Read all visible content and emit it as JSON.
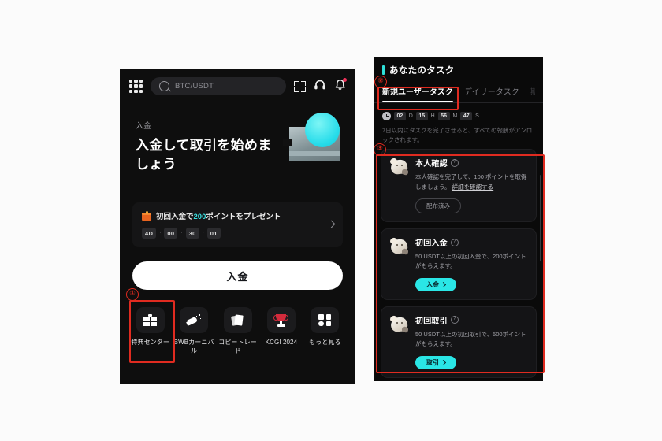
{
  "page": {
    "background": "#fbfbfb",
    "accent_cyan": "#2ae6e6",
    "annotation_red": "#e02b20"
  },
  "left_phone": {
    "topbar": {
      "menu_icon": "grid-menu-icon",
      "search_value": "BTC/USDT",
      "scan_icon": "scan-qr-icon",
      "support_icon": "headset-icon",
      "notification_icon": "bell-icon",
      "notification_dot": true
    },
    "hero": {
      "eyebrow": "入金",
      "title": "入金して取引を始めましょう",
      "art": "wallet-card-illustration"
    },
    "promo": {
      "gift_icon": "gift-box-icon",
      "text_before": "初回入金で",
      "highlight": "200",
      "text_after": "ポイントをプレゼント",
      "timer": [
        "4D",
        "00",
        "30",
        "01"
      ],
      "chevron": "chevron-right-icon"
    },
    "cta_label": "入金",
    "quick_actions": [
      {
        "icon": "gift-icon",
        "label": "特典センター"
      },
      {
        "icon": "megaphone-icon",
        "label": "BWBカーニバル"
      },
      {
        "icon": "copy-trade-icon",
        "label": "コピートレード"
      },
      {
        "icon": "trophy-icon",
        "label": "KCGI 2024"
      },
      {
        "icon": "more-grid-icon",
        "label": "もっと見る"
      }
    ]
  },
  "right_phone": {
    "header_title": "あなたのタスク",
    "tabs": [
      {
        "label": "新規ユーザータスク",
        "active": true
      },
      {
        "label": "デイリータスク",
        "active": false
      },
      {
        "label": "期間",
        "active": false,
        "cut_off": true
      }
    ],
    "countdown": {
      "clock_icon": "clock-icon",
      "days": "02",
      "days_unit": "D",
      "hours": "15",
      "hours_unit": "H",
      "minutes": "56",
      "minutes_unit": "M",
      "seconds": "47",
      "seconds_unit": "S"
    },
    "note": "7日以内にタスクを完了させると、すべての報酬がアンロックされます。",
    "tasks": [
      {
        "emoji": "bear-mascot-icon",
        "title": "本人確認",
        "info_icon": "question-mark-icon",
        "desc": "本人確認を完了して、100 ポイントを取得しましょう。",
        "link": "詳細を確認する",
        "button": {
          "label": "配布済み",
          "style": "ghost"
        }
      },
      {
        "emoji": "bear-mascot-icon",
        "title": "初回入金",
        "info_icon": "question-mark-icon",
        "desc": "50 USDT以上の初回入金で、200ポイントがもらえます。",
        "link": "",
        "button": {
          "label": "入金",
          "style": "cyan"
        }
      },
      {
        "emoji": "bear-mascot-icon",
        "title": "初回取引",
        "info_icon": "question-mark-icon",
        "desc": "50 USDT以上の初回取引で、500ポイントがもらえます。",
        "link": "",
        "button": {
          "label": "取引",
          "style": "cyan"
        }
      }
    ]
  },
  "annotations": [
    {
      "number": "①",
      "target": "特典センター quick action"
    },
    {
      "number": "②",
      "target": "新規ユーザータスク tab"
    },
    {
      "number": "③",
      "target": "task list"
    }
  ]
}
